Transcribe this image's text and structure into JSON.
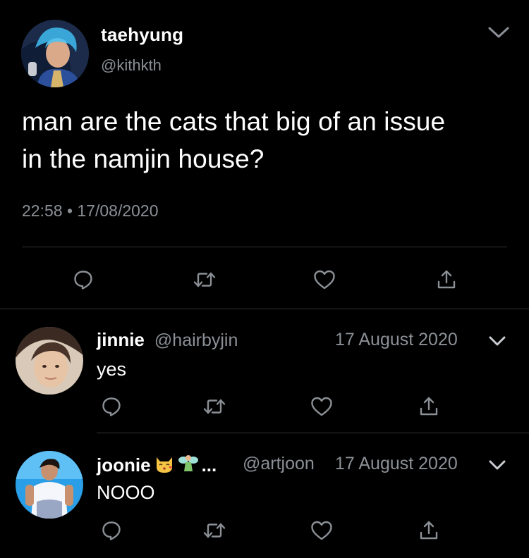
{
  "tweet": {
    "name": "taehyung",
    "handle": "@kithkth",
    "text_line1": "man are the cats that big of an issue",
    "text_line2": "in the namjin house?",
    "timestamp": "22:58 • 17/08/2020",
    "icons": [
      "reply-icon",
      "retweet-icon",
      "like-icon",
      "share-icon"
    ]
  },
  "replies": [
    {
      "name": "jinnie",
      "handle": "@hairbyjin",
      "date": "17 August 2020",
      "text": "yes"
    },
    {
      "name": "joonie",
      "name_emojis": [
        "kissing-cat-emoji",
        "fairy-emoji"
      ],
      "name_ellipsis": "...",
      "handle": "@artjoon",
      "date": "17 August 2020",
      "text": "NOOO"
    }
  ],
  "colors": {
    "background": "#000000",
    "text": "#ffffff",
    "secondary": "#8b9096",
    "divider": "#2f3336"
  }
}
